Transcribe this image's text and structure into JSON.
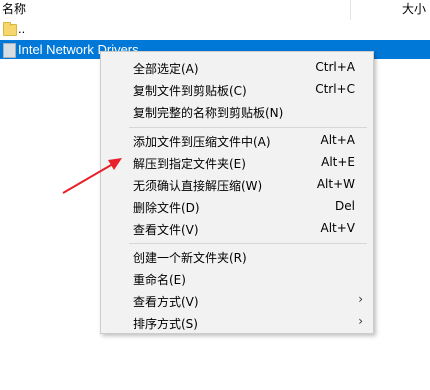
{
  "list": {
    "columns": {
      "name": "名称",
      "size": "大小"
    },
    "parent_label": "..",
    "selected_label": "Intel Network Drivers"
  },
  "menu": {
    "items": [
      {
        "label": "全部选定(A)",
        "shortcut": "Ctrl+A"
      },
      {
        "label": "复制文件到剪贴板(C)",
        "shortcut": "Ctrl+C"
      },
      {
        "label": "复制完整的名称到剪贴板(N)",
        "shortcut": ""
      },
      {
        "label": "添加文件到压缩文件中(A)",
        "shortcut": "Alt+A"
      },
      {
        "label": "解压到指定文件夹(E)",
        "shortcut": "Alt+E"
      },
      {
        "label": "无须确认直接解压缩(W)",
        "shortcut": "Alt+W"
      },
      {
        "label": "删除文件(D)",
        "shortcut": "Del"
      },
      {
        "label": "查看文件(V)",
        "shortcut": "Alt+V"
      },
      {
        "label": "创建一个新文件夹(R)",
        "shortcut": ""
      },
      {
        "label": "重命名(E)",
        "shortcut": ""
      },
      {
        "label": "查看方式(V)",
        "submenu": "›"
      },
      {
        "label": "排序方式(S)",
        "submenu": "›"
      }
    ]
  },
  "colors": {
    "selection": "#0078d7",
    "annotation_arrow": "#e8202a"
  }
}
